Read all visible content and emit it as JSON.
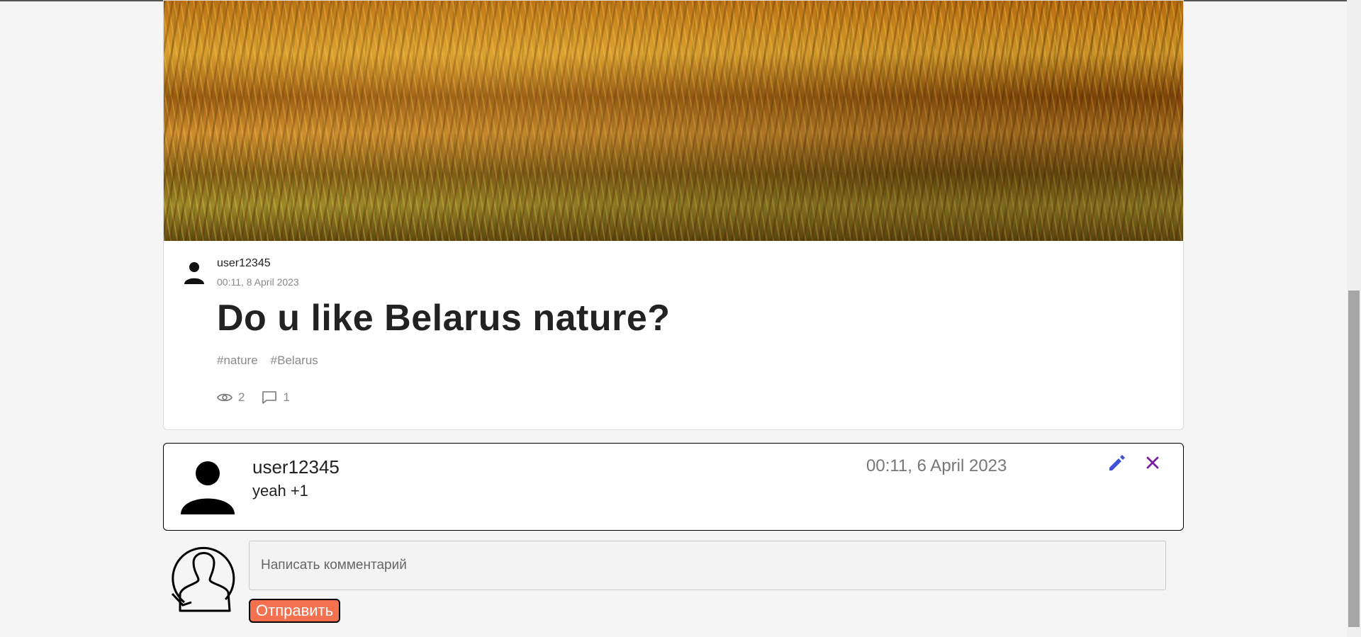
{
  "post": {
    "author": "user12345",
    "date": "00:11, 8 April 2023",
    "title": "Do u like Belarus nature?",
    "tags": [
      "#nature",
      "#Belarus"
    ],
    "views": "2",
    "comments_count": "1",
    "icons": {
      "author": "user-icon",
      "views": "eye-icon",
      "comments": "comment-icon"
    }
  },
  "comment": {
    "user": "user12345",
    "text": "yeah +1",
    "date": "00:11, 6 April 2023",
    "edit_icon": "pencil-icon",
    "delete_icon": "close-icon",
    "edit_color": "#3f51d8",
    "delete_color": "#7b1fa2"
  },
  "new_comment": {
    "placeholder": "Написать комментарий",
    "submit_label": "Отправить",
    "submit_color": "#f4714f"
  }
}
